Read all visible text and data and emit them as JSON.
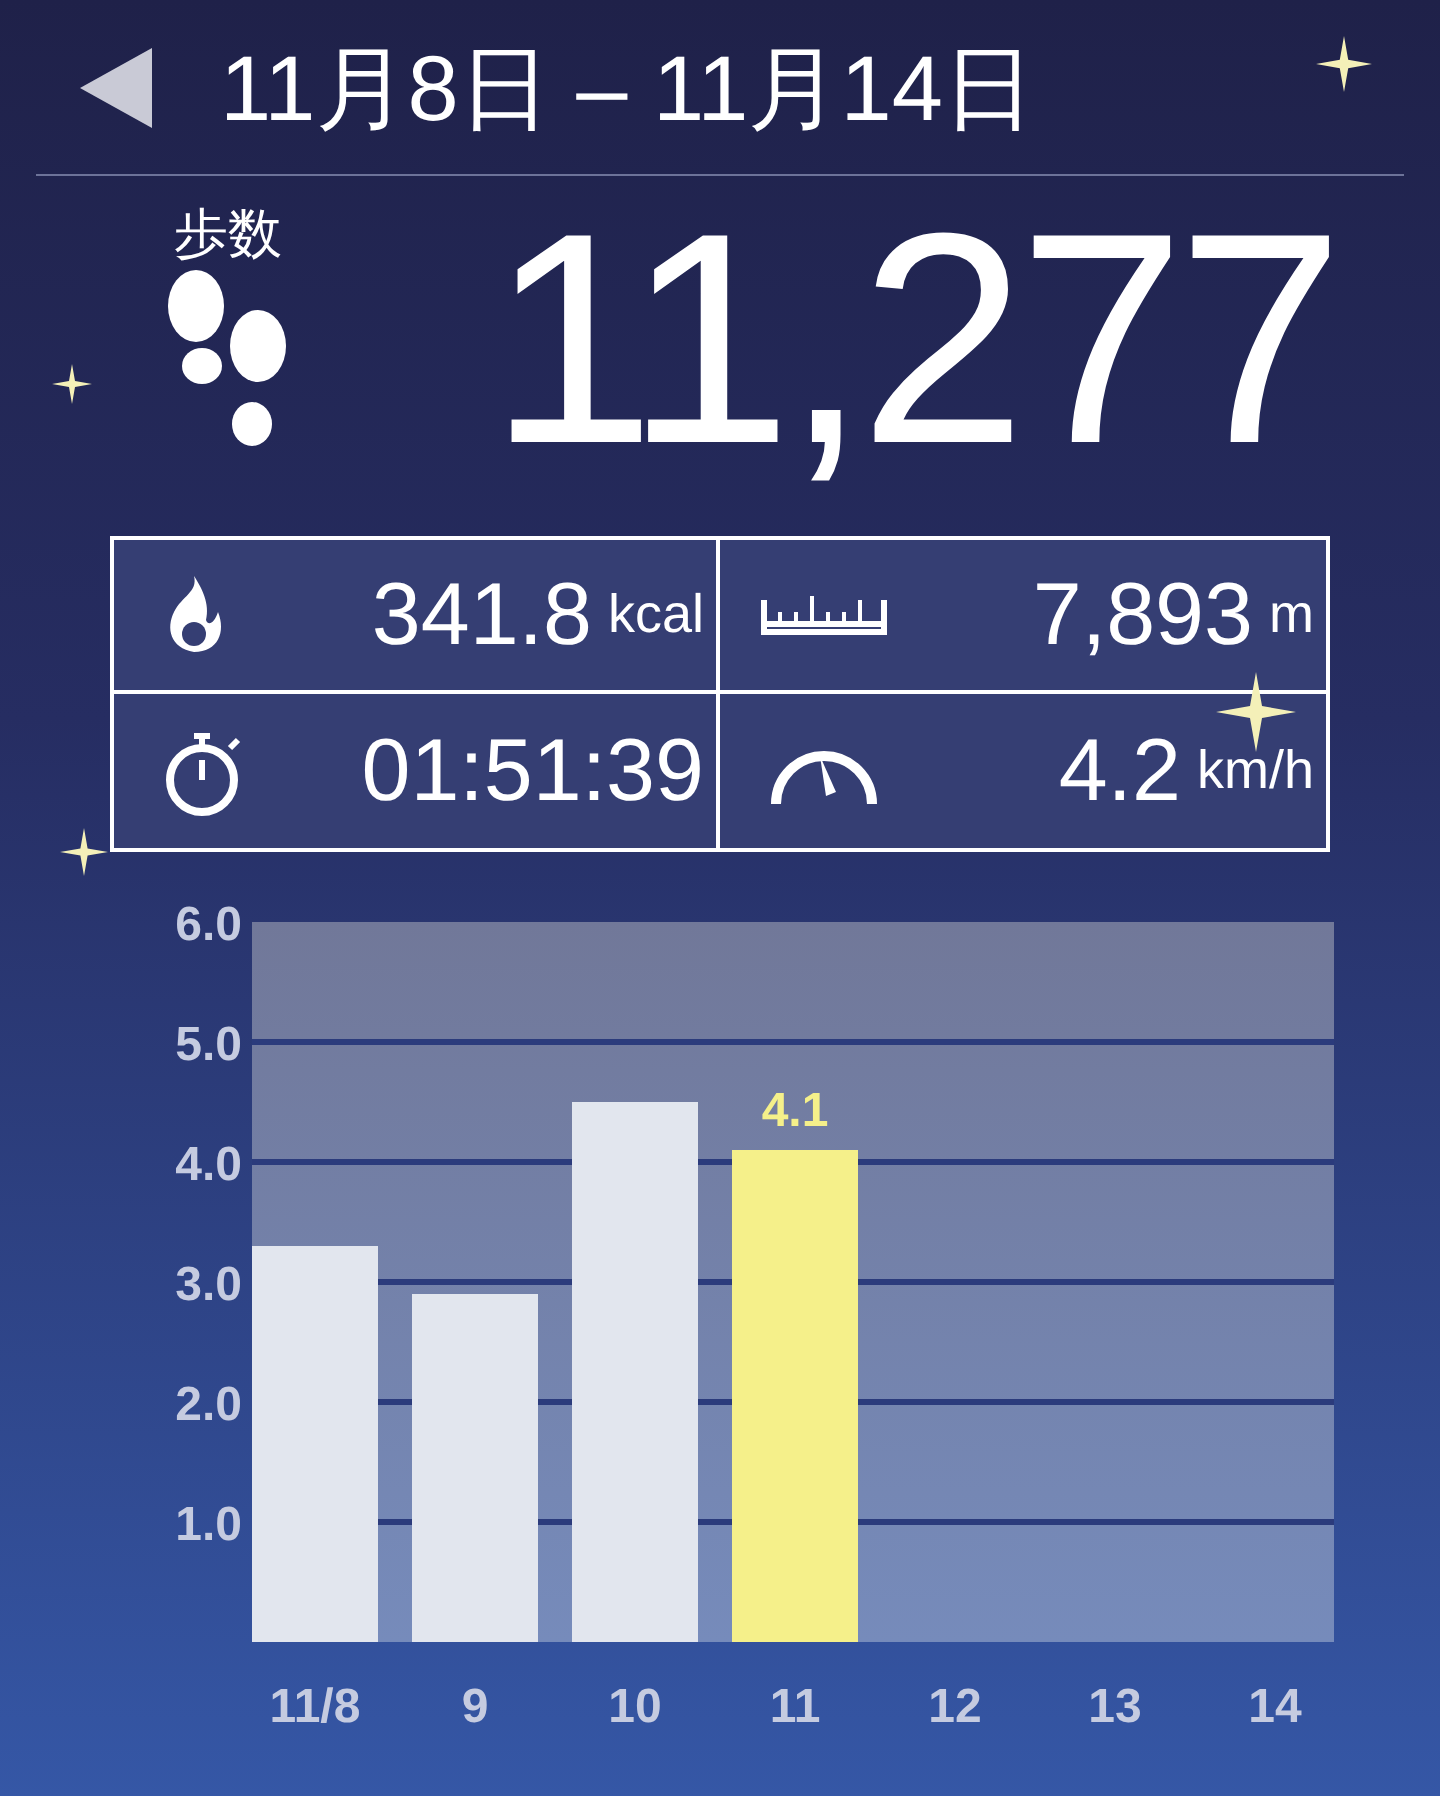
{
  "header": {
    "title": "11月8日 – 11月14日"
  },
  "steps": {
    "label": "歩数",
    "value": "11,277"
  },
  "stats": [
    {
      "kind": "calories",
      "value": "341.8",
      "unit": "kcal"
    },
    {
      "kind": "distance",
      "value": "7,893",
      "unit": "m"
    },
    {
      "kind": "time",
      "value": "01:51:39"
    },
    {
      "kind": "speed",
      "value": "4.2",
      "unit": "km/h"
    }
  ],
  "chart": {
    "chart_data": {
      "type": "bar",
      "categories": [
        "11/8",
        "9",
        "10",
        "11",
        "12",
        "13",
        "14"
      ],
      "series": [
        {
          "color": "#e2e6ee",
          "values": [
            3.3,
            2.9,
            4.5,
            null,
            null,
            null,
            null
          ]
        },
        {
          "color": "#f5f08a",
          "values": [
            null,
            null,
            null,
            4.1,
            null,
            null,
            null
          ]
        }
      ],
      "stacked": true,
      "grid": true,
      "ylim": [
        0,
        6
      ],
      "yticks": [
        {
          "value": 1,
          "label": "1.0"
        },
        {
          "value": 2,
          "label": "2.0"
        },
        {
          "value": 3,
          "label": "3.0"
        },
        {
          "value": 4,
          "label": "4.0"
        },
        {
          "value": 5,
          "label": "5.0"
        },
        {
          "value": 6,
          "label": "6.0"
        }
      ],
      "annotations": [
        {
          "x": "11",
          "y": 4.1,
          "text": "4.1"
        }
      ]
    }
  }
}
